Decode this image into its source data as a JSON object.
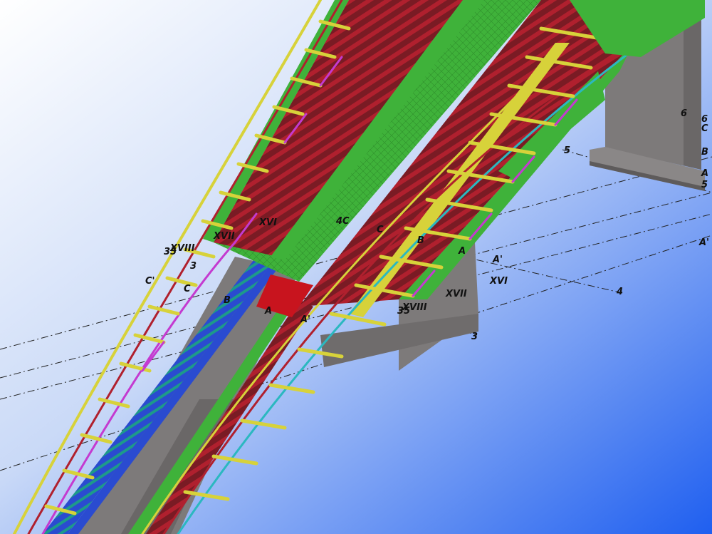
{
  "view": {
    "background_top": "#ffffff",
    "background_bottom": "#1f5ff0",
    "colors": {
      "concrete": "#7d7a7a",
      "concrete_dark": "#5e5b5b",
      "deck_green": "#3fb23a",
      "stringer_blue": "#2a4bd0",
      "rail_yellow": "#d7d23a",
      "post_magenta": "#c43ad0",
      "bar_red": "#b0202e",
      "cyan_member": "#2bb8c0",
      "red_panel": "#c8141e",
      "grid_line": "#222222"
    }
  },
  "labels": {
    "l_6a": "6",
    "l_6b": "6",
    "l_C1": "C",
    "l_B1": "B",
    "l_5a": "5",
    "l_A1": "A",
    "l_5b": "5",
    "l_A2": "A'",
    "l_A3": "A",
    "l_A4": "A'",
    "l_XVI1": "XVI",
    "l_4a": "4",
    "l_XVII1": "XVII",
    "l_35a": "35",
    "l_XVIII1": "XVIII",
    "l_3a": "3",
    "l_XVI2": "XVI",
    "l_4C": "4C",
    "l_C2": "C",
    "l_B2": "B",
    "l_XVII2": "XVII",
    "l_35b": "35",
    "l_XVIII2": "XVIII",
    "l_3b": "3",
    "l_C3": "C'",
    "l_C4": "C",
    "l_B3": "B",
    "l_A5": "A",
    "l_A6": "A'"
  }
}
